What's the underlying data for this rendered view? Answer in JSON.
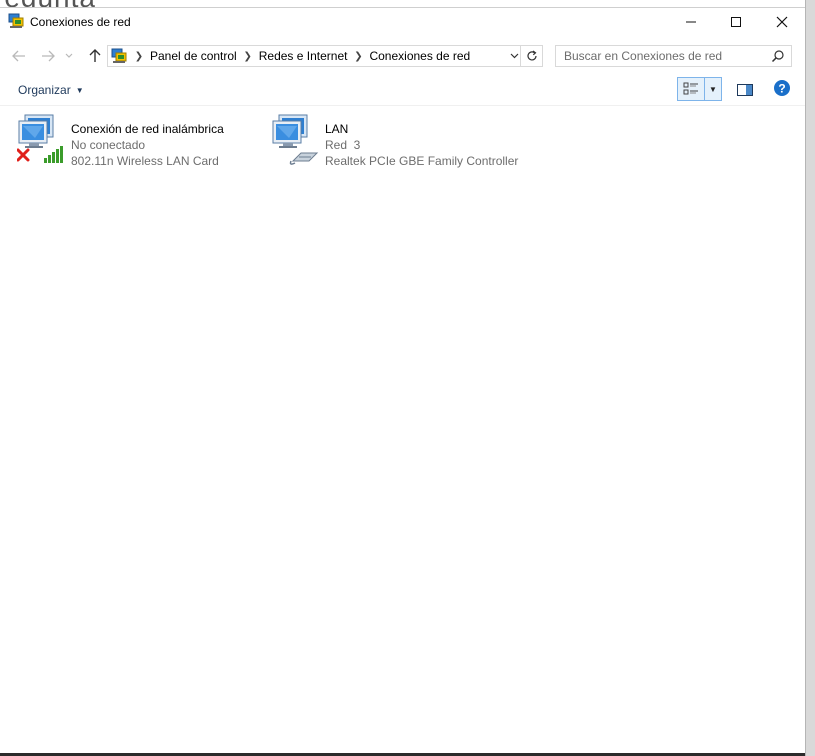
{
  "window": {
    "title": "Conexiones de red"
  },
  "background_text": "regunta",
  "address_bar": {
    "breadcrumbs": [
      "Panel de control",
      "Redes e Internet",
      "Conexiones de red"
    ]
  },
  "search": {
    "placeholder": "Buscar en Conexiones de red"
  },
  "toolbar": {
    "organize_label": "Organizar"
  },
  "connections": [
    {
      "name": "Conexión de red inalámbrica",
      "status": "No conectado",
      "device": "802.11n Wireless LAN Card",
      "icon": "wireless-network-icon"
    },
    {
      "name": "LAN",
      "status": "Red  3",
      "device": "Realtek PCIe GBE Family Controller",
      "icon": "ethernet-network-icon"
    }
  ],
  "colors": {
    "accent": "#1e395b",
    "help": "#1a6fc9",
    "disconnected": "#e0201b",
    "signal": "#3b9c2b",
    "secondary_text": "#6d6d6d"
  }
}
